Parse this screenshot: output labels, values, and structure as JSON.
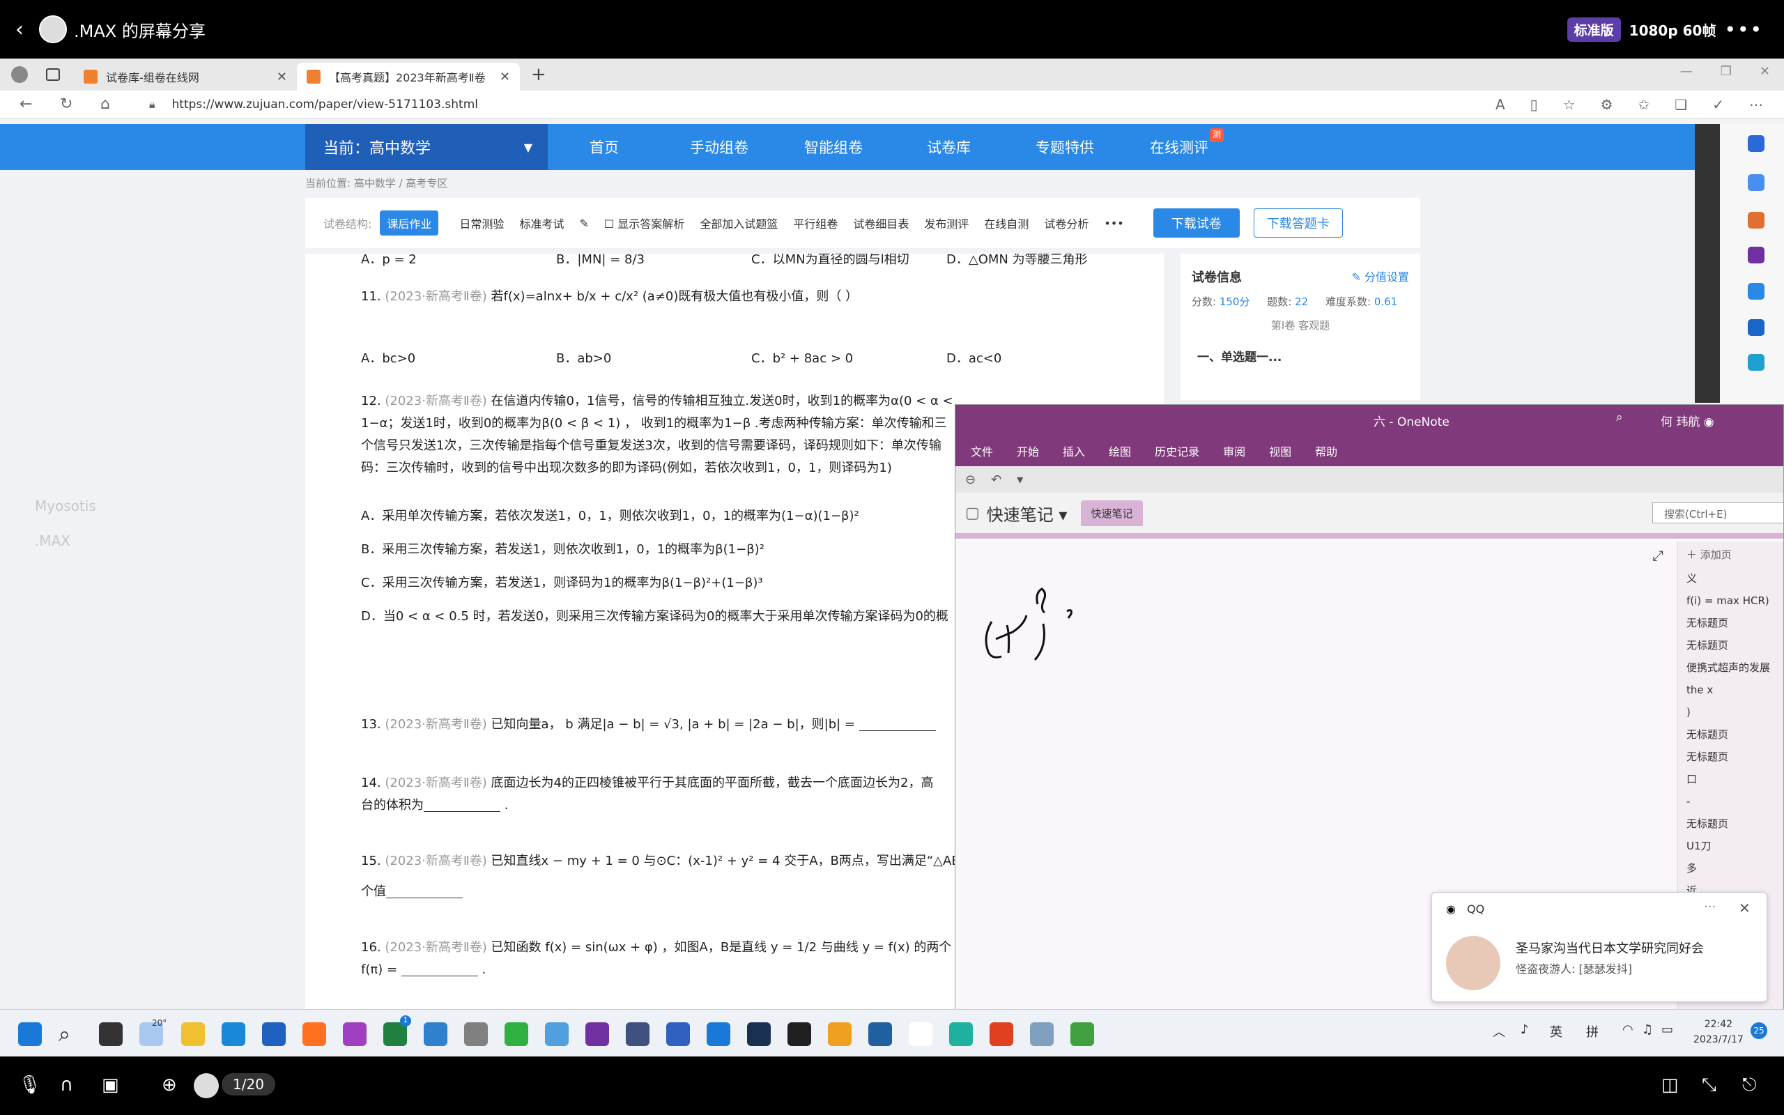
{
  "share": {
    "back_icon": "chevron-left-icon",
    "title": ".MAX 的屏幕分享",
    "edition": "标准版",
    "quality": "1080p 60帧",
    "more": "•••"
  },
  "browser": {
    "tabs": [
      {
        "label": "试卷库-组卷在线网",
        "close": "✕"
      },
      {
        "label": "【高考真题】2023年新高考Ⅱ卷",
        "close": "✕"
      }
    ],
    "new_tab": "+",
    "url": "https://www.zujuan.com/paper/view-5171103.shtml"
  },
  "site": {
    "subject": "当前：高中数学",
    "nav": [
      "首页",
      "手动组卷",
      "智能组卷",
      "试卷库",
      "专题特供",
      "在线测评"
    ],
    "hot_badge": "测",
    "breadcrumb": "当前位置:    高中数学  / 高考专区",
    "toolbar": {
      "label": "试卷结构:",
      "active": "课后作业",
      "items": [
        "日常测验",
        "标准考试",
        "显示答案解析",
        "全部加入试题篮",
        "平行组卷",
        "试卷细目表",
        "发布测评",
        "在线自测",
        "试卷分析",
        "•••"
      ],
      "download": "下载试卷",
      "download_card": "下载答题卡"
    },
    "info": {
      "title": "试卷信息",
      "score_setting": "分值设置",
      "score_label": "分数:",
      "score": "150分",
      "count_label": "题数:",
      "count": "22",
      "difficulty_label": "难度系数:",
      "difficulty": "0.61",
      "section": "第Ⅰ卷 客观题",
      "single": "一、单选题一..."
    }
  },
  "questions": {
    "prev_opts": [
      "A．p = 2",
      "B．|MN| = 8/3",
      "C．以MN为直径的圆与l相切",
      "D．△OMN 为等腰三角形"
    ],
    "q11": {
      "num": "11.",
      "src": "(2023·新高考Ⅱ卷)",
      "text": "若f(x)=alnx+ b/x + c/x² (a≠0)既有极大值也有极小值，则（  ）"
    },
    "q11_opts": [
      "A．bc>0",
      "B．ab>0",
      "C．b² + 8ac > 0",
      "D．ac<0"
    ],
    "q12": {
      "num": "12.",
      "src": "(2023·新高考Ⅱ卷)",
      "line1": "在信道内传输0，1信号，信号的传输相互独立.发送0时，收到1的概率为α(0 < α <",
      "line2": "1−α；发送1时，收到0的概率为β(0 < β < 1) ， 收到1的概率为1−β .考虑两种传输方案：单次传输和三",
      "line3": "个信号只发送1次，三次传输是指每个信号重复发送3次，收到的信号需要译码，译码规则如下：单次传输",
      "line4": "码：三次传输时，收到的信号中出现次数多的即为译码(例如，若依次收到1，0，1，则译码为1)"
    },
    "q12_opts": [
      "A．采用单次传输方案，若依次发送1，0，1，则依次收到1，0，1的概率为(1−α)(1−β)²",
      "B．采用三次传输方案，若发送1，则依次收到1，0，1的概率为β(1−β)²",
      "C．采用三次传输方案，若发送1，则译码为1的概率为β(1−β)²+(1−β)³",
      "D．当0 < α < 0.5 时，若发送0，则采用三次传输方案译码为0的概率大于采用单次传输方案译码为0的概"
    ],
    "q13": {
      "num": "13.",
      "src": "(2023·新高考Ⅱ卷)",
      "text": "已知向量a， b 满足|a − b| = √3, |a + b| = |2a − b|，则|b| = "
    },
    "q14": {
      "num": "14.",
      "src": "(2023·新高考Ⅱ卷)",
      "text": "底面边长为4的正四棱锥被平行于其底面的平面所截，截去一个底面边长为2，高",
      "text2": "台的体积为"
    },
    "q15": {
      "num": "15.",
      "src": "(2023·新高考Ⅱ卷)",
      "text": "已知直线x − my + 1 = 0 与⊙C：(x-1)² + y² = 4 交于A，B两点，写出满足“△AB",
      "text2": "个值"
    },
    "q16": {
      "num": "16.",
      "src": "(2023·新高考Ⅱ卷)",
      "text": "已知函数 f(x) = sin(ωx + φ) ，如图A，B是直线 y = 1/2 与曲线 y = f(x) 的两个",
      "text2": "f(π) = "
    }
  },
  "watermarks": [
    "Myosotis",
    ".MAX"
  ],
  "onenote": {
    "title": "六 - OneNote",
    "user": "何 玮航",
    "menu": [
      "文件",
      "开始",
      "插入",
      "绘图",
      "历史记录",
      "审阅",
      "视图",
      "帮助"
    ],
    "notebook": "快速笔记",
    "section": "快速笔记",
    "search_placeholder": "搜索(Ctrl+E)",
    "add_page": "添加页",
    "pages": [
      "义",
      "f(i) = max HCR)",
      "无标题页",
      "无标题页",
      "便携式超声的发展",
      "the x",
      ")",
      "无标题页",
      "无标题页",
      "口",
      "-",
      "无标题页",
      "U1刀",
      "多",
      "近"
    ]
  },
  "qq": {
    "app": "QQ",
    "group": "圣马家沟当代日本文学研究同好会",
    "message": "怪盗夜游人: [瑟瑟发抖]"
  },
  "taskbar": {
    "weather": "20°",
    "badge": "1",
    "lang": "英",
    "ime": "拼",
    "time": "22:42",
    "date": "2023/7/17",
    "notif": "25"
  },
  "bottom": {
    "page_count": "1/20"
  }
}
